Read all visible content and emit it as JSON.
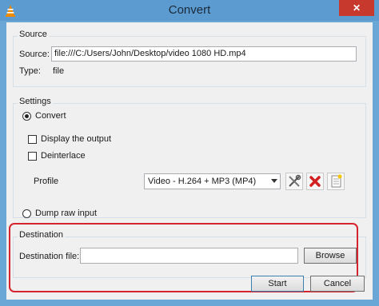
{
  "window": {
    "title": "Convert",
    "close_symbol": "✕"
  },
  "source": {
    "group_label": "Source",
    "source_label": "Source:",
    "source_value": "file:///C:/Users/John/Desktop/video 1080 HD.mp4",
    "type_label": "Type:",
    "type_value": "file"
  },
  "settings": {
    "group_label": "Settings",
    "convert_label": "Convert",
    "convert_selected": true,
    "display_output_label": "Display the output",
    "display_output_checked": false,
    "deinterlace_label": "Deinterlace",
    "deinterlace_checked": false,
    "profile_label": "Profile",
    "profile_value": "Video - H.264 + MP3 (MP4)",
    "tools": [
      "edit-profile-icon",
      "delete-profile-icon",
      "new-profile-icon"
    ],
    "dump_raw_label": "Dump raw input",
    "dump_raw_selected": false
  },
  "destination": {
    "group_label": "Destination",
    "file_label": "Destination file:",
    "file_value": "",
    "browse_label": "Browse"
  },
  "buttons": {
    "start_label": "Start",
    "cancel_label": "Cancel"
  },
  "colors": {
    "titlebar": "#5b9bd0",
    "close": "#c7392c",
    "highlight": "#d6242f"
  }
}
